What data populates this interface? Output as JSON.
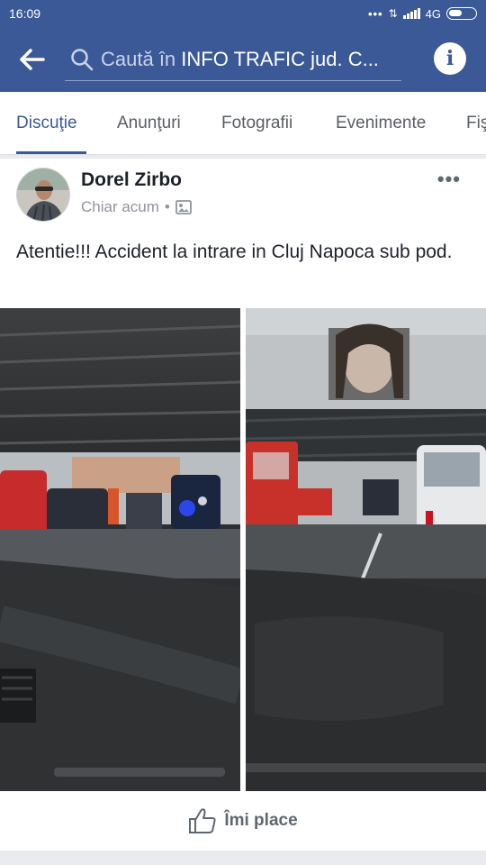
{
  "status_bar": {
    "time": "16:09",
    "network": "4G"
  },
  "header": {
    "search_placeholder": "Caută în",
    "search_group": "INFO TRAFIC jud. C...",
    "back_icon": "back-arrow-icon",
    "info_icon": "info-icon"
  },
  "tabs": [
    {
      "label": "Discuţie",
      "active": true
    },
    {
      "label": "Anunţuri",
      "active": false
    },
    {
      "label": "Fotografii",
      "active": false
    },
    {
      "label": "Evenimente",
      "active": false
    },
    {
      "label": "Fiş",
      "active": false
    }
  ],
  "post": {
    "author": "Dorel Zirbo",
    "timestamp": "Chiar acum",
    "separator": "•",
    "privacy_icon": "group-photo-icon",
    "text": "Atentie!!! Accident la intrare in Cluj Napoca sub pod.",
    "more_icon": "more-dots-icon",
    "photos": [
      {
        "description_icon": "photo-accident-under-bridge-1"
      },
      {
        "description_icon": "photo-accident-under-bridge-2"
      }
    ],
    "like_label": "Îmi place",
    "like_icon": "thumbs-up-icon"
  },
  "colors": {
    "brand": "#3b5997",
    "active_tab": "#3b5997",
    "text": "#1d2129",
    "muted": "#90949c"
  }
}
